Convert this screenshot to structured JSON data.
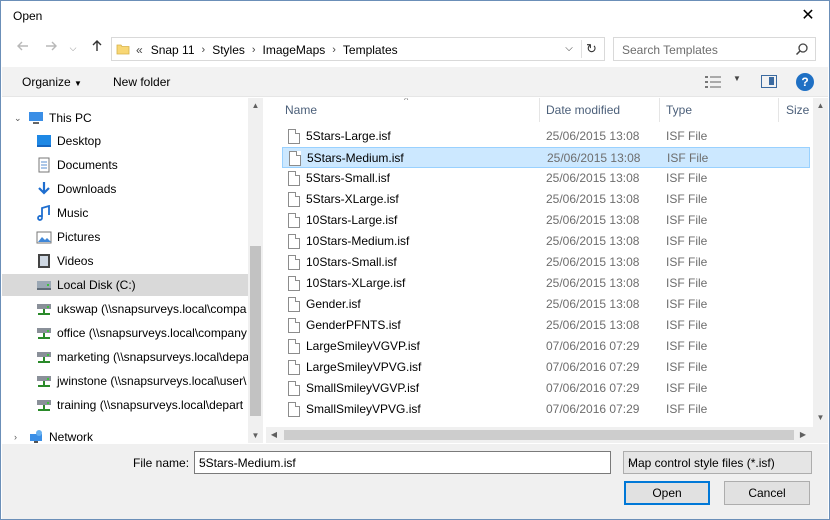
{
  "window": {
    "title": "Open",
    "close_glyph": "✕"
  },
  "nav": {
    "back_icon": "back-arrow-icon",
    "forward_icon": "forward-arrow-icon",
    "up_icon": "up-arrow-icon",
    "overflow": "«",
    "breadcrumbs": [
      "Snap 11",
      "Styles",
      "ImageMaps",
      "Templates"
    ],
    "search_placeholder": "Search Templates"
  },
  "toolbar": {
    "organize_label": "Organize",
    "new_folder_label": "New folder",
    "help_glyph": "?"
  },
  "sidebar": {
    "items": [
      {
        "label": "This PC",
        "icon": "computer-icon",
        "level": 0
      },
      {
        "label": "Desktop",
        "icon": "desktop-icon",
        "level": 1
      },
      {
        "label": "Documents",
        "icon": "documents-icon",
        "level": 1
      },
      {
        "label": "Downloads",
        "icon": "downloads-icon",
        "level": 1
      },
      {
        "label": "Music",
        "icon": "music-icon",
        "level": 1
      },
      {
        "label": "Pictures",
        "icon": "pictures-icon",
        "level": 1
      },
      {
        "label": "Videos",
        "icon": "videos-icon",
        "level": 1
      },
      {
        "label": "Local Disk (C:)",
        "icon": "local-disk-icon",
        "level": 1,
        "selected": true
      },
      {
        "label": "ukswap (\\\\snapsurveys.local\\compa",
        "icon": "network-drive-icon",
        "level": 1
      },
      {
        "label": "office (\\\\snapsurveys.local\\company",
        "icon": "network-drive-icon",
        "level": 1
      },
      {
        "label": "marketing (\\\\snapsurveys.local\\depa",
        "icon": "network-drive-icon",
        "level": 1
      },
      {
        "label": "jwinstone (\\\\snapsurveys.local\\user\\",
        "icon": "network-drive-icon",
        "level": 1
      },
      {
        "label": "training (\\\\snapsurveys.local\\depart",
        "icon": "network-drive-icon",
        "level": 1
      },
      {
        "label": "Network",
        "icon": "network-icon",
        "level": 0
      }
    ]
  },
  "files": {
    "columns": {
      "name": "Name",
      "date": "Date modified",
      "type": "Type",
      "size": "Size"
    },
    "rows": [
      {
        "name": "5Stars-Large.isf",
        "date": "25/06/2015 13:08",
        "type": "ISF File"
      },
      {
        "name": "5Stars-Medium.isf",
        "date": "25/06/2015 13:08",
        "type": "ISF File",
        "selected": true
      },
      {
        "name": "5Stars-Small.isf",
        "date": "25/06/2015 13:08",
        "type": "ISF File"
      },
      {
        "name": "5Stars-XLarge.isf",
        "date": "25/06/2015 13:08",
        "type": "ISF File"
      },
      {
        "name": "10Stars-Large.isf",
        "date": "25/06/2015 13:08",
        "type": "ISF File"
      },
      {
        "name": "10Stars-Medium.isf",
        "date": "25/06/2015 13:08",
        "type": "ISF File"
      },
      {
        "name": "10Stars-Small.isf",
        "date": "25/06/2015 13:08",
        "type": "ISF File"
      },
      {
        "name": "10Stars-XLarge.isf",
        "date": "25/06/2015 13:08",
        "type": "ISF File"
      },
      {
        "name": "Gender.isf",
        "date": "25/06/2015 13:08",
        "type": "ISF File"
      },
      {
        "name": "GenderPFNTS.isf",
        "date": "25/06/2015 13:08",
        "type": "ISF File"
      },
      {
        "name": "LargeSmileyVGVP.isf",
        "date": "07/06/2016 07:29",
        "type": "ISF File"
      },
      {
        "name": "LargeSmileyVPVG.isf",
        "date": "07/06/2016 07:29",
        "type": "ISF File"
      },
      {
        "name": "SmallSmileyVGVP.isf",
        "date": "07/06/2016 07:29",
        "type": "ISF File"
      },
      {
        "name": "SmallSmileyVPVG.isf",
        "date": "07/06/2016 07:29",
        "type": "ISF File"
      }
    ]
  },
  "footer": {
    "file_name_label": "File name:",
    "file_name_value": "5Stars-Medium.isf",
    "filter_value": "Map control style files (*.isf)",
    "open_label": "Open",
    "cancel_label": "Cancel"
  },
  "colors": {
    "selection": "#cce8ff",
    "accent": "#0078d7",
    "help": "#1f70c4"
  }
}
